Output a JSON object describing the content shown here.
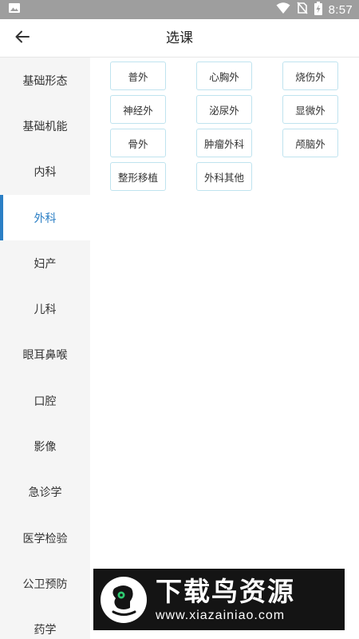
{
  "status_bar": {
    "time": "8:57",
    "icons": [
      "image-icon",
      "wifi-icon",
      "no-sim-icon",
      "battery-charging-icon"
    ]
  },
  "app_bar": {
    "back_icon": "arrow-left-icon",
    "title": "选课"
  },
  "sidebar": {
    "active_index": 3,
    "accent_color": "#2b7fc5",
    "items": [
      {
        "label": "基础形态"
      },
      {
        "label": "基础机能"
      },
      {
        "label": "内科"
      },
      {
        "label": "外科"
      },
      {
        "label": "妇产"
      },
      {
        "label": "儿科"
      },
      {
        "label": "眼耳鼻喉"
      },
      {
        "label": "口腔"
      },
      {
        "label": "影像"
      },
      {
        "label": "急诊学"
      },
      {
        "label": "医学检验"
      },
      {
        "label": "公卫预防"
      },
      {
        "label": "药学"
      }
    ]
  },
  "courses": {
    "border_color": "#bfe3ef",
    "items": [
      {
        "label": "普外"
      },
      {
        "label": "心胸外"
      },
      {
        "label": "烧伤外"
      },
      {
        "label": "神经外"
      },
      {
        "label": "泌尿外"
      },
      {
        "label": "显微外"
      },
      {
        "label": "骨外"
      },
      {
        "label": "肿瘤外科"
      },
      {
        "label": "颅脑外"
      },
      {
        "label": "整形移植"
      },
      {
        "label": "外科其他"
      }
    ]
  },
  "watermark": {
    "title": "下载鸟资源",
    "url": "www.xiazainiao.com",
    "logo_icon": "bird-logo-icon"
  }
}
